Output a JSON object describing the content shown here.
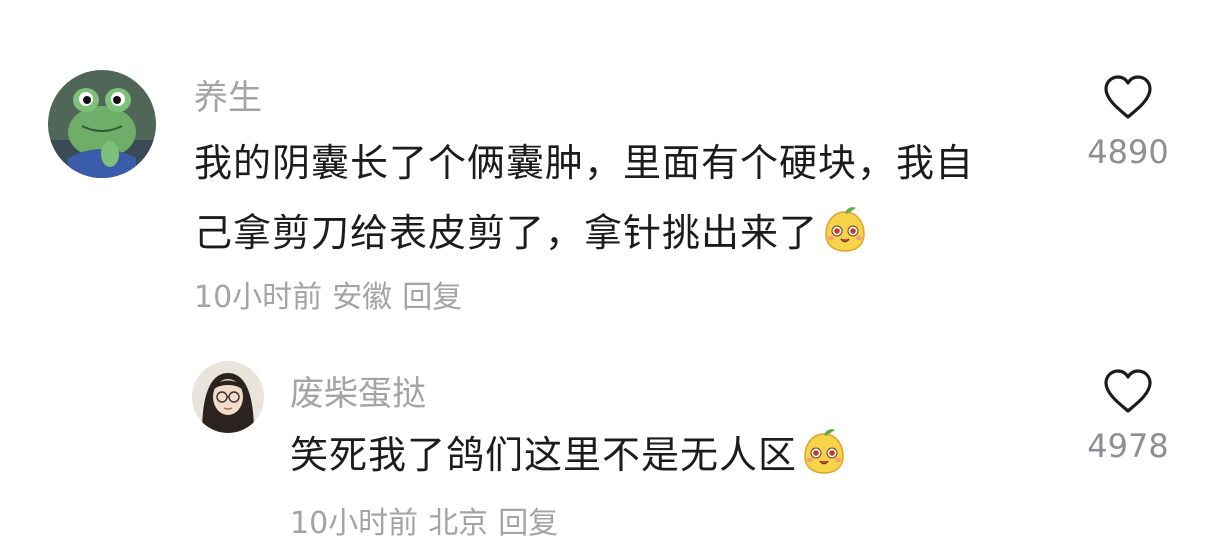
{
  "comments": [
    {
      "username": "养生",
      "text_lines": [
        "我的阴囊长了个俩囊肿，里面有个硬块，我自",
        "己拿剪刀给表皮剪了，拿针挑出来了"
      ],
      "emoji_icon": "mango-face-emoji-icon",
      "time": "10小时前",
      "location": "安徽",
      "reply_label": "回复",
      "like_count": "4890",
      "avatar": "frog-avatar"
    },
    {
      "username": "废柴蛋挞",
      "text_lines": [
        "笑死我了鸽们这里不是无人区"
      ],
      "emoji_icon": "mango-face-emoji-icon",
      "time": "10小时前",
      "location": "北京",
      "reply_label": "回复",
      "like_count": "4978",
      "avatar": "girl-avatar"
    }
  ],
  "colors": {
    "text": "#1c1c1e",
    "muted": "#a3a3a8",
    "count": "#8e8e93",
    "emoji_face": "#f7d34a"
  }
}
